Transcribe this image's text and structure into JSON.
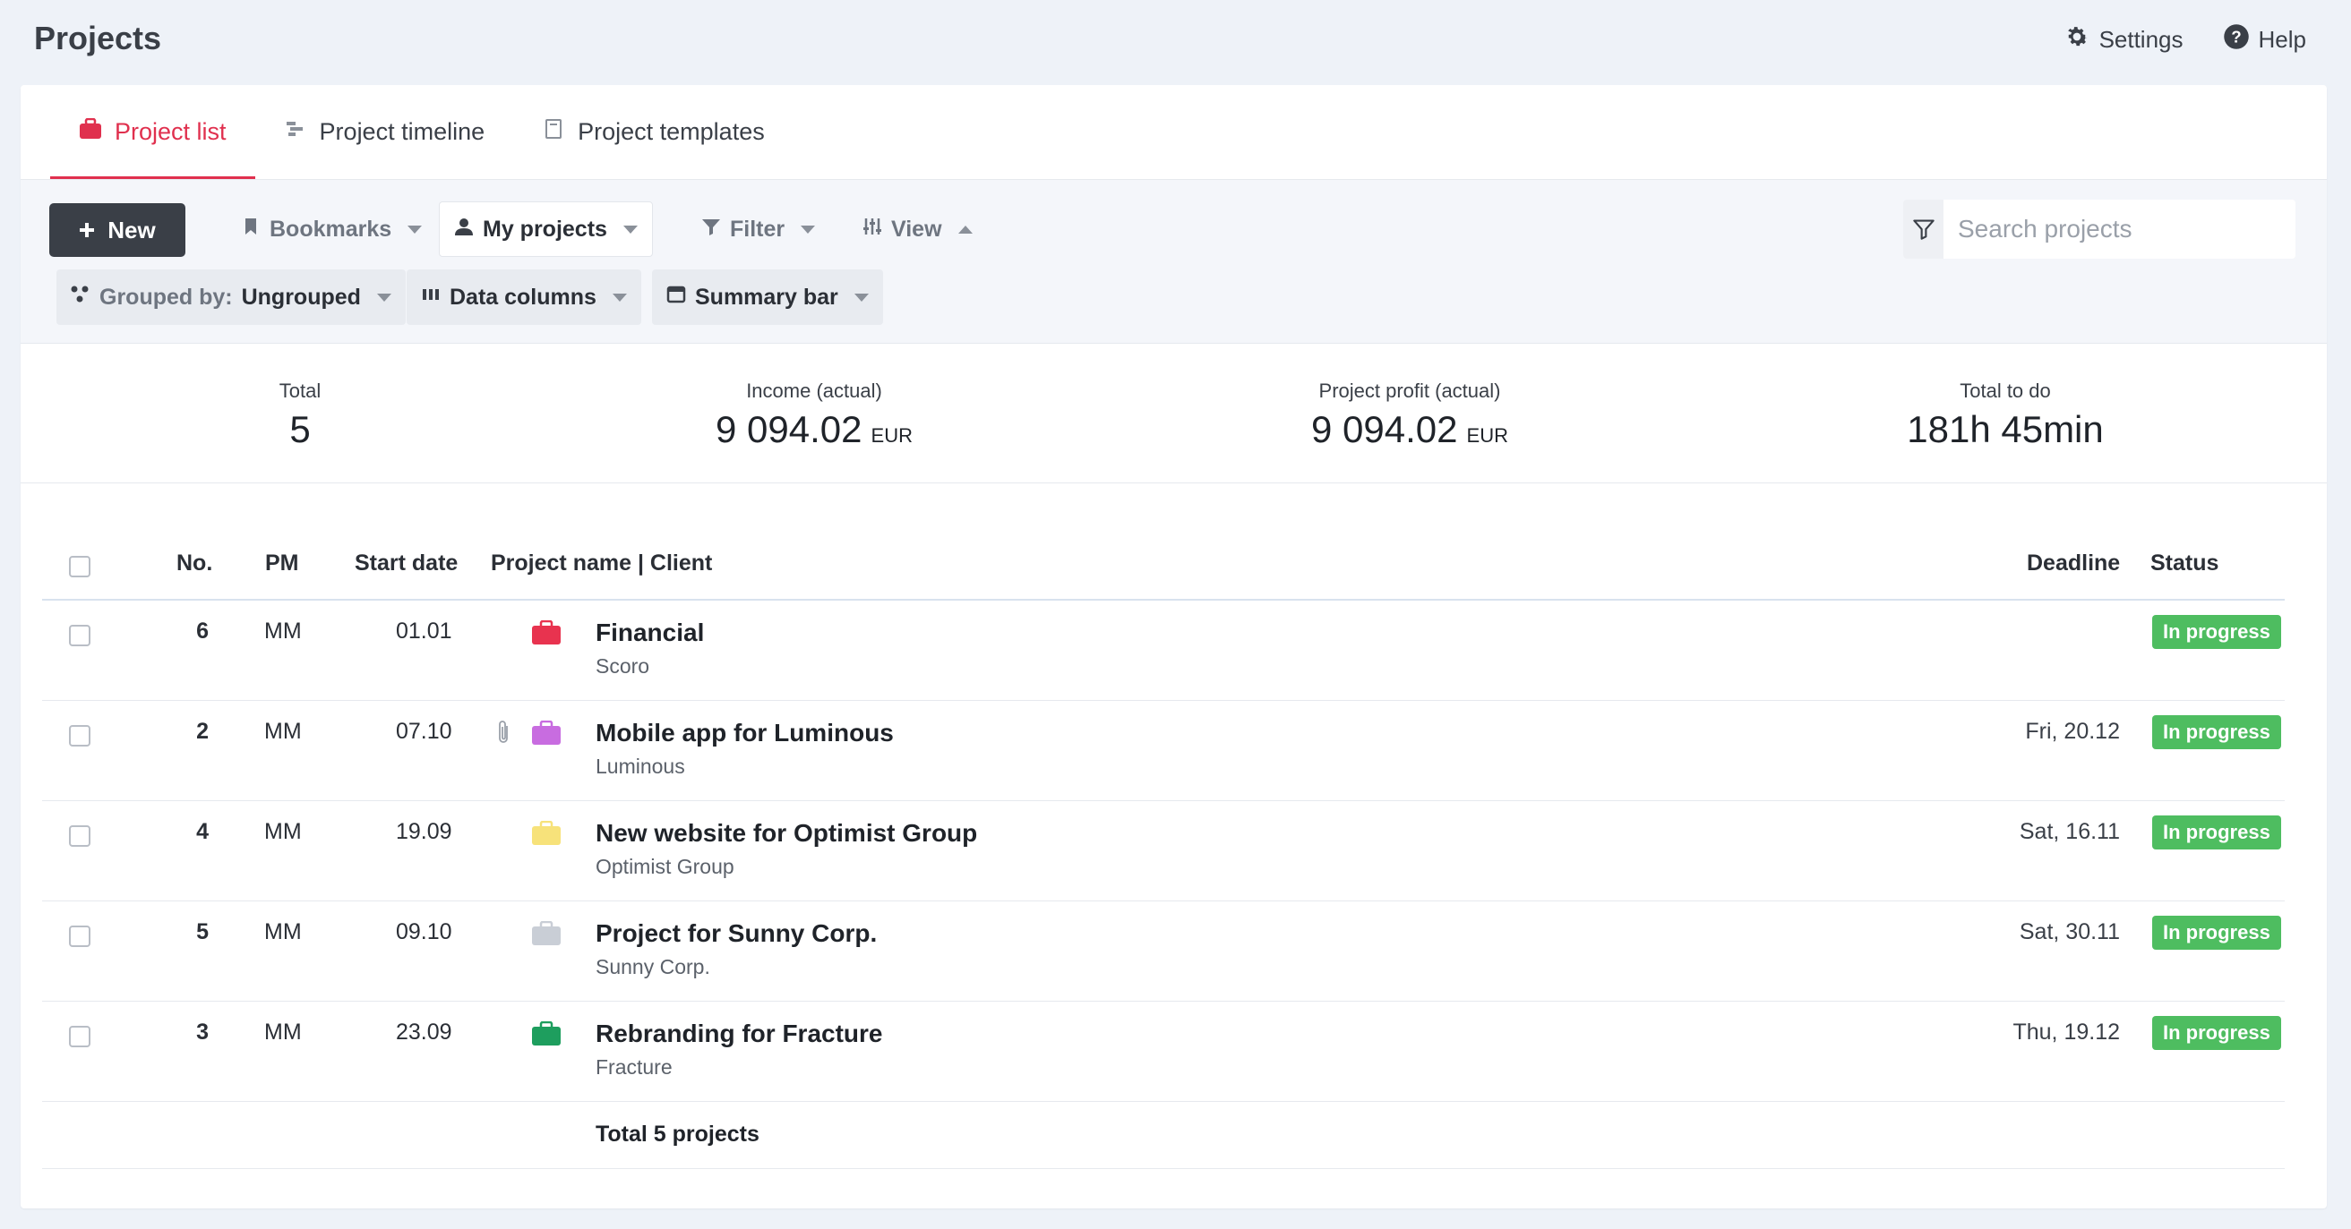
{
  "page": {
    "title": "Projects"
  },
  "top_actions": {
    "settings": "Settings",
    "help": "Help"
  },
  "tabs": [
    {
      "label": "Project list",
      "icon": "briefcase-icon",
      "active": true
    },
    {
      "label": "Project timeline",
      "icon": "timeline-icon",
      "active": false
    },
    {
      "label": "Project templates",
      "icon": "template-icon",
      "active": false
    }
  ],
  "toolbar": {
    "new_label": "New",
    "bookmarks_label": "Bookmarks",
    "my_projects_label": "My projects",
    "filter_label": "Filter",
    "view_label": "View",
    "grouped_by_prefix": "Grouped by:",
    "grouped_by_value": "Ungrouped",
    "data_columns_label": "Data columns",
    "summary_bar_label": "Summary bar"
  },
  "search": {
    "placeholder": "Search projects"
  },
  "summary": {
    "total_label": "Total",
    "total_value": "5",
    "income_label": "Income (actual)",
    "income_value": "9 094.02",
    "income_unit": "EUR",
    "profit_label": "Project profit (actual)",
    "profit_value": "9 094.02",
    "profit_unit": "EUR",
    "todo_label": "Total to do",
    "todo_value": "181h 45min"
  },
  "table": {
    "headers": {
      "no": "No.",
      "pm": "PM",
      "start_date": "Start date",
      "project_client": "Project name | Client",
      "deadline": "Deadline",
      "status": "Status"
    },
    "rows": [
      {
        "no": "6",
        "pm": "MM",
        "start": "01.01",
        "name": "Financial",
        "client": "Scoro",
        "deadline": "",
        "status": "In progress",
        "color": "#e8334f",
        "attachment": false
      },
      {
        "no": "2",
        "pm": "MM",
        "start": "07.10",
        "name": "Mobile app for Luminous",
        "client": "Luminous",
        "deadline": "Fri, 20.12",
        "status": "In progress",
        "color": "#c86ce0",
        "attachment": true
      },
      {
        "no": "4",
        "pm": "MM",
        "start": "19.09",
        "name": "New website for Optimist Group",
        "client": "Optimist Group",
        "deadline": "Sat, 16.11",
        "status": "In progress",
        "color": "#f7e27a",
        "attachment": false
      },
      {
        "no": "5",
        "pm": "MM",
        "start": "09.10",
        "name": "Project for Sunny Corp.",
        "client": "Sunny Corp.",
        "deadline": "Sat, 30.11",
        "status": "In progress",
        "color": "#c9ced6",
        "attachment": false
      },
      {
        "no": "3",
        "pm": "MM",
        "start": "23.09",
        "name": "Rebranding for Fracture",
        "client": "Fracture",
        "deadline": "Thu, 19.12",
        "status": "In progress",
        "color": "#1e9e5e",
        "attachment": false
      }
    ],
    "total_text": "Total 5 projects"
  },
  "colors": {
    "accent": "#e0304e",
    "status_green": "#4ebd60",
    "dark_button": "#3a3f47"
  }
}
